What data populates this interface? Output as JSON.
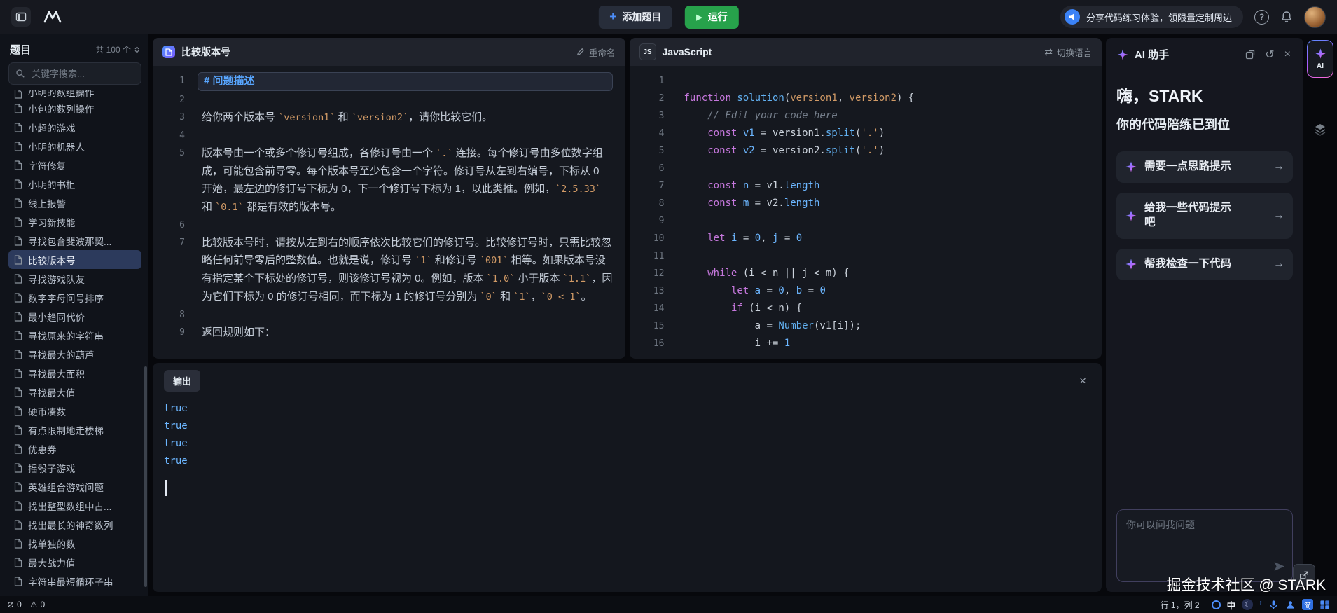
{
  "topbar": {
    "add_button": "添加题目",
    "run_button": "运行",
    "promo_text": "分享代码练习体验，领限量定制周边"
  },
  "sidebar": {
    "title": "题目",
    "count": "共 100 个",
    "search_placeholder": "关键字搜索...",
    "items": [
      {
        "label": "小明的数组操作",
        "clipped": true
      },
      {
        "label": "小包的数列操作"
      },
      {
        "label": "小超的游戏"
      },
      {
        "label": "小明的机器人"
      },
      {
        "label": "字符修复"
      },
      {
        "label": "小明的书柜"
      },
      {
        "label": "线上报警"
      },
      {
        "label": "学习新技能"
      },
      {
        "label": "寻找包含斐波那契..."
      },
      {
        "label": "比较版本号",
        "selected": true
      },
      {
        "label": "寻找游戏队友"
      },
      {
        "label": "数字字母问号排序"
      },
      {
        "label": "最小趋同代价"
      },
      {
        "label": "寻找原来的字符串"
      },
      {
        "label": "寻找最大的葫芦"
      },
      {
        "label": "寻找最大面积"
      },
      {
        "label": "寻找最大值"
      },
      {
        "label": "硬币凑数"
      },
      {
        "label": "有点限制地走楼梯"
      },
      {
        "label": "优惠券"
      },
      {
        "label": "摇骰子游戏"
      },
      {
        "label": "英雄组合游戏问题"
      },
      {
        "label": "找出整型数组中占..."
      },
      {
        "label": "找出最长的神奇数列"
      },
      {
        "label": "找单独的数"
      },
      {
        "label": "最大战力值"
      },
      {
        "label": "字符串最短循环子串"
      }
    ]
  },
  "problem": {
    "title": "比较版本号",
    "rename_label": "重命名",
    "lines": [
      {
        "n": 1,
        "h": true,
        "seg": [
          {
            "t": "# 问题描述"
          }
        ]
      },
      {
        "n": 2,
        "seg": []
      },
      {
        "n": 3,
        "seg": [
          {
            "t": "给你两个版本号 "
          },
          {
            "c": 1,
            "t": "`version1`"
          },
          {
            "t": " 和 "
          },
          {
            "c": 1,
            "t": "`version2`"
          },
          {
            "t": "，请你比较它们。"
          }
        ]
      },
      {
        "n": 4,
        "seg": []
      },
      {
        "n": 5,
        "seg": [
          {
            "t": "版本号由一个或多个修订号组成，各修订号由一个 "
          },
          {
            "c": 1,
            "t": "`.`"
          },
          {
            "t": " 连接。每个修订号由多位数字组成，可能包含前导零。每个版本号至少包含一个字符。修订号从左到右编号，下标从 0 开始，最左边的修订号下标为 0，下一个修订号下标为 1，以此类推。例如，"
          },
          {
            "c": 1,
            "t": "`2.5.33`"
          },
          {
            "t": " 和 "
          },
          {
            "c": 1,
            "t": "`0.1`"
          },
          {
            "t": " 都是有效的版本号。"
          }
        ]
      },
      {
        "n": 6,
        "seg": []
      },
      {
        "n": 7,
        "seg": [
          {
            "t": "比较版本号时，请按从左到右的顺序依次比较它们的修订号。比较修订号时，只需比较忽略任何前导零后的整数值。也就是说，修订号 "
          },
          {
            "c": 1,
            "t": "`1`"
          },
          {
            "t": " 和修订号 "
          },
          {
            "c": 1,
            "t": "`001`"
          },
          {
            "t": " 相等。如果版本号没有指定某个下标处的修订号，则该修订号视为 0。例如，版本 "
          },
          {
            "c": 1,
            "t": "`1.0`"
          },
          {
            "t": " 小于版本 "
          },
          {
            "c": 1,
            "t": "`1.1`"
          },
          {
            "t": "，因为它们下标为 0 的修订号相同，而下标为 1 的修订号分别为 "
          },
          {
            "c": 1,
            "t": "`0`"
          },
          {
            "t": " 和 "
          },
          {
            "c": 1,
            "t": "`1`"
          },
          {
            "t": "，"
          },
          {
            "c": 1,
            "t": "`0 < 1`"
          },
          {
            "t": "。"
          }
        ]
      },
      {
        "n": 8,
        "seg": []
      },
      {
        "n": 9,
        "seg": [
          {
            "t": "返回规则如下："
          }
        ]
      }
    ]
  },
  "code": {
    "lang_badge": "JS",
    "lang_name": "JavaScript",
    "switch_label": "切换语言",
    "lines": [
      {
        "n": 1,
        "tk": []
      },
      {
        "n": 2,
        "tk": [
          [
            "kw",
            "function"
          ],
          [
            "tx",
            " "
          ],
          [
            "fn",
            "solution"
          ],
          [
            "tx",
            "("
          ],
          [
            "pa",
            "version1"
          ],
          [
            "tx",
            ", "
          ],
          [
            "pa",
            "version2"
          ],
          [
            "tx",
            ") {"
          ]
        ]
      },
      {
        "n": 3,
        "tk": [
          [
            "cm",
            "    // Edit your code here"
          ]
        ]
      },
      {
        "n": 4,
        "tk": [
          [
            "tx",
            "    "
          ],
          [
            "kw",
            "const"
          ],
          [
            "tx",
            " "
          ],
          [
            "vr",
            "v1"
          ],
          [
            "tx",
            " = version1."
          ],
          [
            "fn",
            "split"
          ],
          [
            "tx",
            "("
          ],
          [
            "st",
            "'.'"
          ],
          [
            "tx",
            ")"
          ]
        ]
      },
      {
        "n": 5,
        "tk": [
          [
            "tx",
            "    "
          ],
          [
            "kw",
            "const"
          ],
          [
            "tx",
            " "
          ],
          [
            "vr",
            "v2"
          ],
          [
            "tx",
            " = version2."
          ],
          [
            "fn",
            "split"
          ],
          [
            "tx",
            "("
          ],
          [
            "st",
            "'.'"
          ],
          [
            "tx",
            ")"
          ]
        ]
      },
      {
        "n": 6,
        "tk": []
      },
      {
        "n": 7,
        "tk": [
          [
            "tx",
            "    "
          ],
          [
            "kw",
            "const"
          ],
          [
            "tx",
            " "
          ],
          [
            "vr",
            "n"
          ],
          [
            "tx",
            " = v1."
          ],
          [
            "pr",
            "length"
          ]
        ]
      },
      {
        "n": 8,
        "tk": [
          [
            "tx",
            "    "
          ],
          [
            "kw",
            "const"
          ],
          [
            "tx",
            " "
          ],
          [
            "vr",
            "m"
          ],
          [
            "tx",
            " = v2."
          ],
          [
            "pr",
            "length"
          ]
        ]
      },
      {
        "n": 9,
        "tk": []
      },
      {
        "n": 10,
        "tk": [
          [
            "tx",
            "    "
          ],
          [
            "kw",
            "let"
          ],
          [
            "tx",
            " "
          ],
          [
            "vr",
            "i"
          ],
          [
            "tx",
            " = "
          ],
          [
            "nu",
            "0"
          ],
          [
            "tx",
            ", "
          ],
          [
            "vr",
            "j"
          ],
          [
            "tx",
            " = "
          ],
          [
            "nu",
            "0"
          ]
        ]
      },
      {
        "n": 11,
        "tk": []
      },
      {
        "n": 12,
        "tk": [
          [
            "tx",
            "    "
          ],
          [
            "kw",
            "while"
          ],
          [
            "tx",
            " (i < n || j < m) {"
          ]
        ]
      },
      {
        "n": 13,
        "tk": [
          [
            "tx",
            "        "
          ],
          [
            "kw",
            "let"
          ],
          [
            "tx",
            " "
          ],
          [
            "vr",
            "a"
          ],
          [
            "tx",
            " = "
          ],
          [
            "nu",
            "0"
          ],
          [
            "tx",
            ", "
          ],
          [
            "vr",
            "b"
          ],
          [
            "tx",
            " = "
          ],
          [
            "nu",
            "0"
          ]
        ]
      },
      {
        "n": 14,
        "tk": [
          [
            "tx",
            "        "
          ],
          [
            "kw",
            "if"
          ],
          [
            "tx",
            " (i < n) {"
          ]
        ]
      },
      {
        "n": 15,
        "tk": [
          [
            "tx",
            "            a = "
          ],
          [
            "fn",
            "Number"
          ],
          [
            "tx",
            "(v1[i]);"
          ]
        ]
      },
      {
        "n": 16,
        "tk": [
          [
            "tx",
            "            i += "
          ],
          [
            "nu",
            "1"
          ]
        ]
      }
    ]
  },
  "output": {
    "tab_label": "输出",
    "lines": [
      "true",
      "true",
      "true",
      "true"
    ]
  },
  "ai": {
    "title": "AI 助手",
    "greeting": "嗨，STARK",
    "subtitle": "你的代码陪练已到位",
    "cards": [
      {
        "label": "需要一点思路提示"
      },
      {
        "label": "给我一些代码提示吧"
      },
      {
        "label": "帮我检查一下代码"
      }
    ],
    "input_placeholder": "你可以问我问题",
    "badge_label": "AI"
  },
  "statusbar": {
    "error_count": "0",
    "warning_count": "0",
    "cursor_position": "行 1，列 2",
    "ime_mode": "中",
    "ime_simplified": "简"
  },
  "watermark": "掘金技术社区 @ STARK",
  "icons": {
    "plus": "+",
    "play": "▶",
    "help": "?",
    "close": "×",
    "history": "↺",
    "switch_lang": "⇄",
    "arrow_right": "→",
    "error": "⊘",
    "warning": "⚠",
    "moon": "☾",
    "quote": "’"
  },
  "colors": {
    "accent_blue": "#4d8efa",
    "run_green": "#27a24b",
    "selected_item_bg": "#2c3a5c",
    "heading_blue": "#58a6ff",
    "code_keyword": "#c678dd",
    "code_string": "#d19a66",
    "code_number": "#6cb6ff"
  }
}
